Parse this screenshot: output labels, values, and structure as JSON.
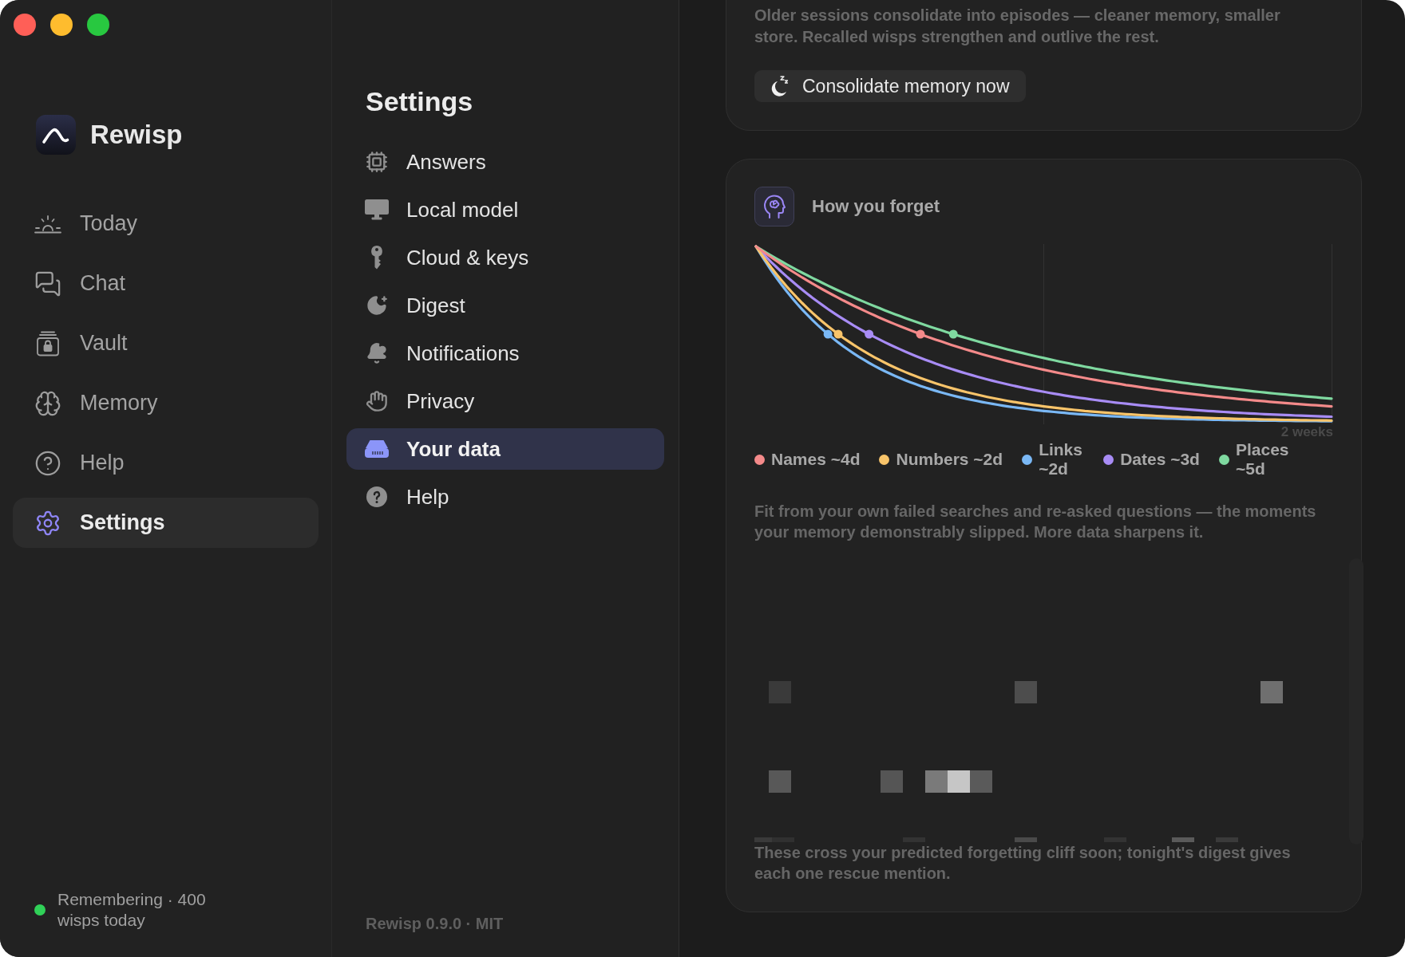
{
  "sidebar": {
    "app_name": "Rewisp",
    "items": [
      {
        "label": "Today",
        "selected": false
      },
      {
        "label": "Chat",
        "selected": false
      },
      {
        "label": "Vault",
        "selected": false
      },
      {
        "label": "Memory",
        "selected": false
      },
      {
        "label": "Help",
        "selected": false
      },
      {
        "label": "Settings",
        "selected": true
      }
    ],
    "status": {
      "text": "Remembering · 400 wisps today",
      "active": true
    }
  },
  "settings_nav": {
    "title": "Settings",
    "items": [
      {
        "label": "Answers",
        "selected": false
      },
      {
        "label": "Local model",
        "selected": false
      },
      {
        "label": "Cloud & keys",
        "selected": false
      },
      {
        "label": "Digest",
        "selected": false
      },
      {
        "label": "Notifications",
        "selected": false
      },
      {
        "label": "Privacy",
        "selected": false
      },
      {
        "label": "Your data",
        "selected": true
      },
      {
        "label": "Help",
        "selected": false
      }
    ],
    "footer": "Rewisp 0.9.0 · MIT"
  },
  "consolidate_card": {
    "description": "Older sessions consolidate into episodes — cleaner memory, smaller store. Recalled wisps strengthen and outlive the rest.",
    "button": "Consolidate memory now"
  },
  "forgetting_card": {
    "title": "How you forget",
    "chart": {
      "end_label": "2 weeks"
    },
    "legend": [
      {
        "label": "Names ~4d",
        "color": "#f48a8a"
      },
      {
        "label": "Numbers ~2d",
        "color": "#f8c46a"
      },
      {
        "label": "Links ~2d",
        "color": "#7ab8f5"
      },
      {
        "label": "Dates ~3d",
        "color": "#a88cf5"
      },
      {
        "label": "Places ~5d",
        "color": "#7fd9a0"
      }
    ],
    "note": "Fit from your own failed searches and re-asked questions — the moments your memory demonstrably slipped. More data sharpens it.",
    "heatmap_note": "These cross your predicted forgetting cliff soon; tonight's digest gives each one rescue mention."
  }
}
